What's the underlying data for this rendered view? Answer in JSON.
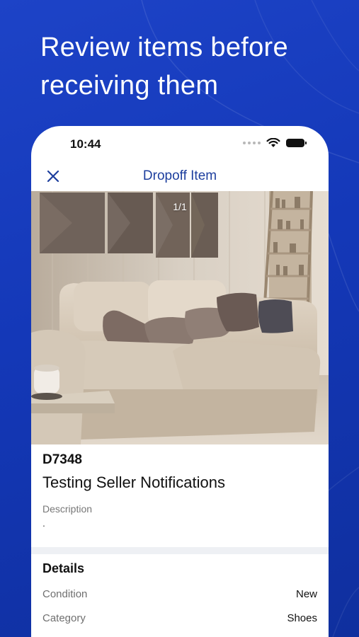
{
  "headline": "Review items before receiving them",
  "headline_lines": [
    "Review items before",
    "receiving them"
  ],
  "colors": {
    "background": "#1438b8",
    "nav_title": "#1e3f9e",
    "card": "#ffffff"
  },
  "status_bar": {
    "time": "10:44",
    "icons": [
      "signal-dots-icon",
      "wifi-icon",
      "battery-icon"
    ]
  },
  "nav": {
    "close_icon": "close-icon",
    "title": "Dropoff Item"
  },
  "photo": {
    "counter": "1/1"
  },
  "item": {
    "code": "D7348",
    "title": "Testing Seller Notifications",
    "description_label": "Description",
    "description_value": "."
  },
  "details": {
    "title": "Details",
    "rows": [
      {
        "label": "Condition",
        "value": "New"
      },
      {
        "label": "Category",
        "value": "Shoes"
      }
    ]
  }
}
